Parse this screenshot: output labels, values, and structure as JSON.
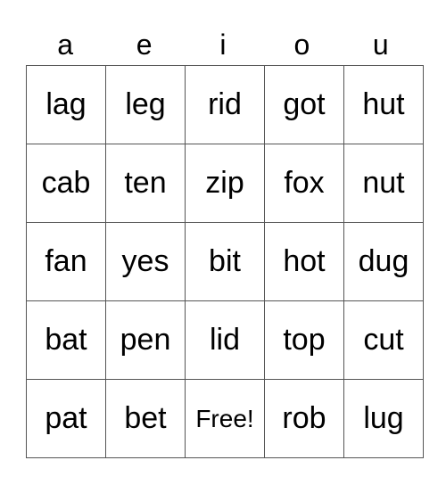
{
  "header": {
    "letters": [
      "a",
      "e",
      "i",
      "o",
      "u"
    ]
  },
  "board": {
    "rows": [
      [
        "lag",
        "leg",
        "rid",
        "got",
        "hut"
      ],
      [
        "cab",
        "ten",
        "zip",
        "fox",
        "nut"
      ],
      [
        "fan",
        "yes",
        "bit",
        "hot",
        "dug"
      ],
      [
        "bat",
        "pen",
        "lid",
        "top",
        "cut"
      ],
      [
        "pat",
        "bet",
        "Free!",
        "rob",
        "lug"
      ]
    ]
  }
}
